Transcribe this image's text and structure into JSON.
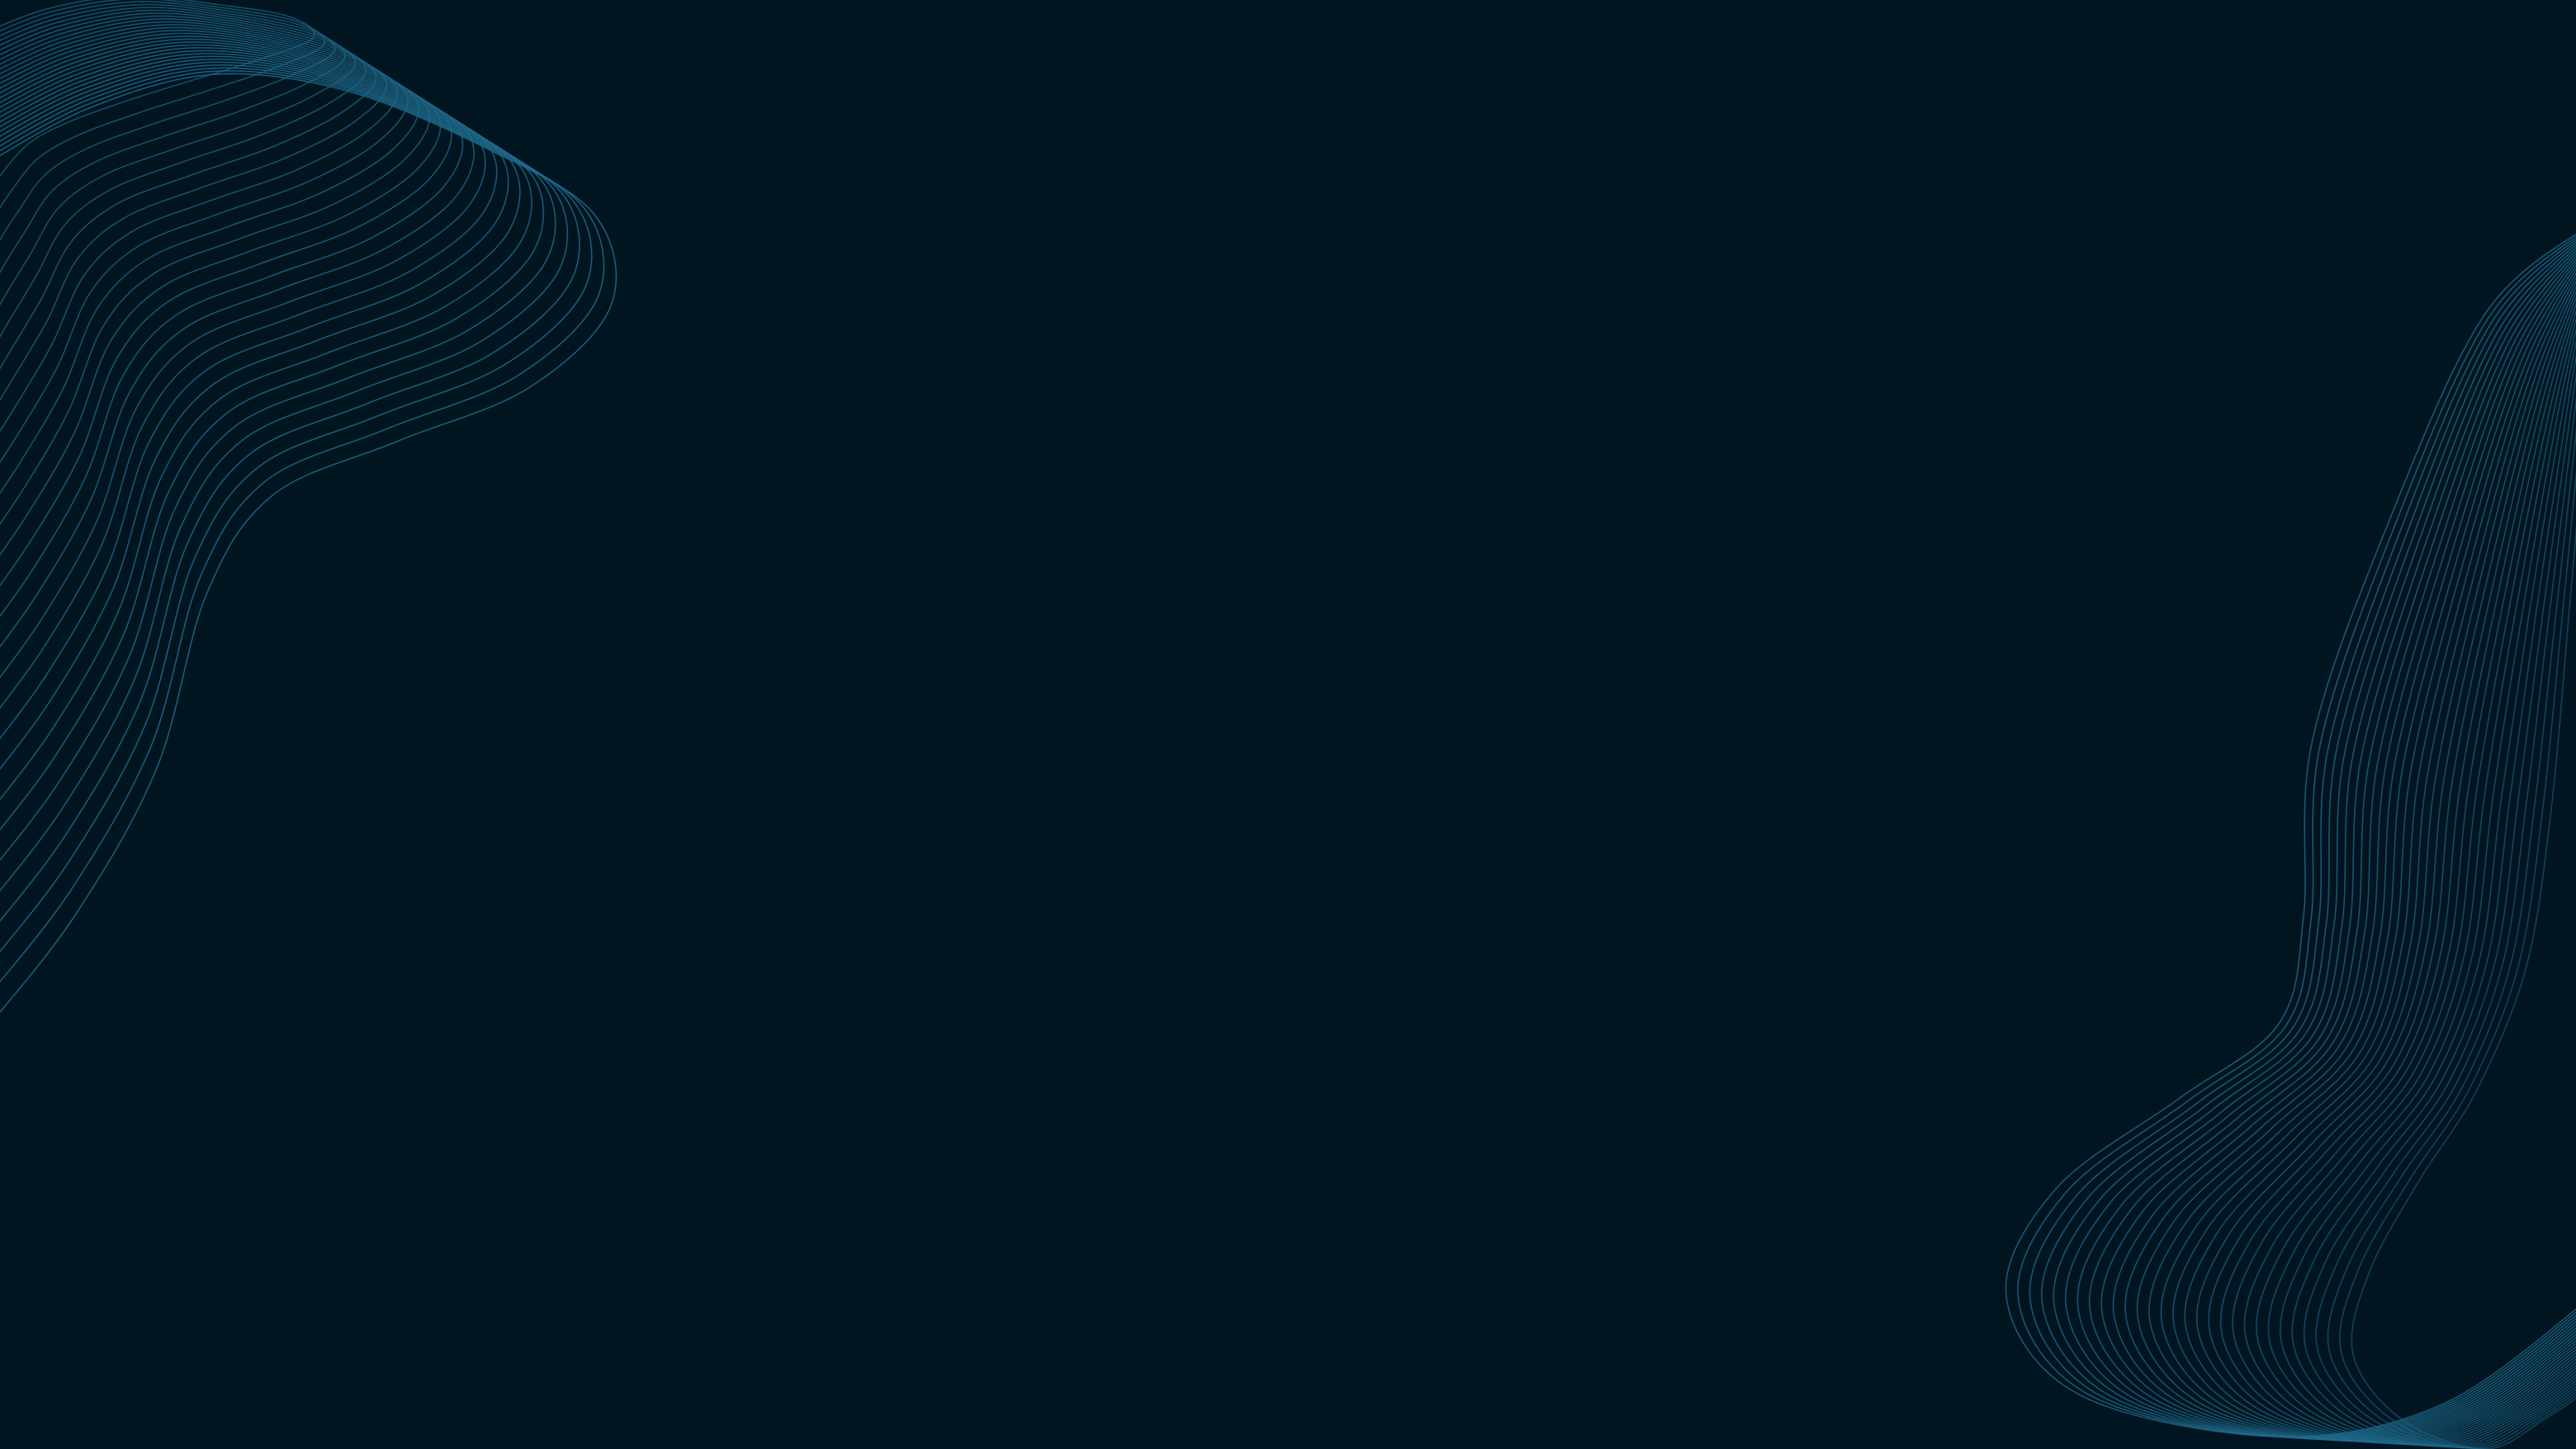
{
  "background": {
    "color": "#011520"
  },
  "waves": {
    "color": "#1f6a8c",
    "top_left": {
      "name": "top-left-wave-contours",
      "line_count": 28
    },
    "bottom_right": {
      "name": "bottom-right-wave-contours",
      "line_count": 30
    }
  }
}
